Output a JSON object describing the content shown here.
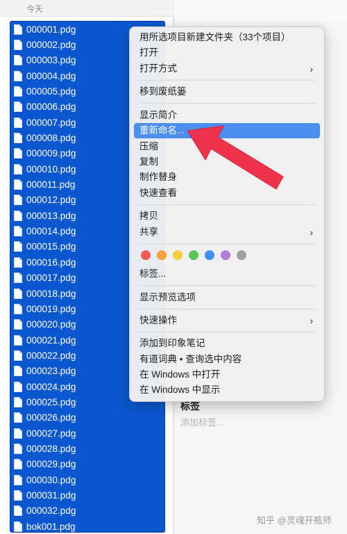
{
  "list_header": {
    "title": "今天"
  },
  "files": [
    "000001.pdg",
    "000002.pdg",
    "000003.pdg",
    "000004.pdg",
    "000005.pdg",
    "000006.pdg",
    "000007.pdg",
    "000008.pdg",
    "000009.pdg",
    "000010.pdg",
    "000011.pdg",
    "000012.pdg",
    "000013.pdg",
    "000014.pdg",
    "000015.pdg",
    "000016.pdg",
    "000017.pdg",
    "000018.pdg",
    "000019.pdg",
    "000020.pdg",
    "000021.pdg",
    "000022.pdg",
    "000023.pdg",
    "000024.pdg",
    "000025.pdg",
    "000026.pdg",
    "000027.pdg",
    "000028.pdg",
    "000029.pdg",
    "000030.pdg",
    "000031.pdg",
    "000032.pdg",
    "bok001.pdg"
  ],
  "context_menu": {
    "new_folder_with_selection": "用所选项目新建文件夹（33个项目）",
    "open": "打开",
    "open_with": "打开方式",
    "move_to_trash": "移到废纸篓",
    "get_info": "显示简介",
    "rename": "重新命名...",
    "compress": "压缩",
    "duplicate": "复制",
    "make_alias": "制作替身",
    "quick_look": "快速查看",
    "copy": "拷贝",
    "share": "共享",
    "tags": "标签...",
    "show_preview_options": "显示预览选项",
    "quick_actions": "快速操作",
    "add_to_evernote": "添加到印象笔记",
    "youdao_lookup": "有道词典 • 查询选中内容",
    "open_in_windows": "在 Windows 中打开",
    "show_in_windows": "在 Windows 中显示",
    "tag_colors": [
      "#f25a55",
      "#f7a23b",
      "#f6cf3e",
      "#58c758",
      "#3d8ff4",
      "#b67ad8",
      "#a0a0a0"
    ]
  },
  "info_panel": {
    "tags_title": "标签",
    "add_tags_placeholder": "添加标签..."
  },
  "watermark": "知乎 @灵魂开瓶师",
  "colors": {
    "selection": "#0b57d0",
    "menu_highlight": "#4a8ff0",
    "annotation": "#f0334d"
  }
}
